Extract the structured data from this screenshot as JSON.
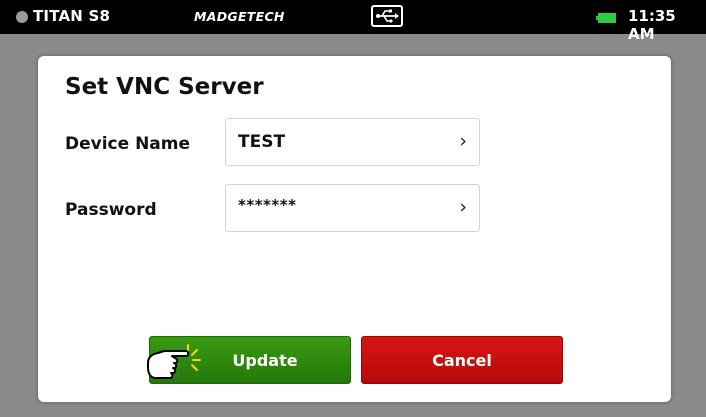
{
  "status_bar": {
    "device_name": "TITAN S8",
    "brand": "MADGETECH",
    "usb_icon": "usb-icon",
    "battery_icon": "battery-icon",
    "time": "11:35 AM"
  },
  "dialog": {
    "title": "Set VNC Server",
    "fields": [
      {
        "label": "Device Name",
        "value": "TEST"
      },
      {
        "label": "Password",
        "value": "*******"
      }
    ],
    "chevron": "›",
    "buttons": {
      "update": "Update",
      "cancel": "Cancel"
    }
  },
  "colors": {
    "status_bar_bg": "#000000",
    "backdrop": "#8a8a8a",
    "update_button": "#2e8a0e",
    "cancel_button": "#c80f0f",
    "battery": "#2ecc40"
  }
}
